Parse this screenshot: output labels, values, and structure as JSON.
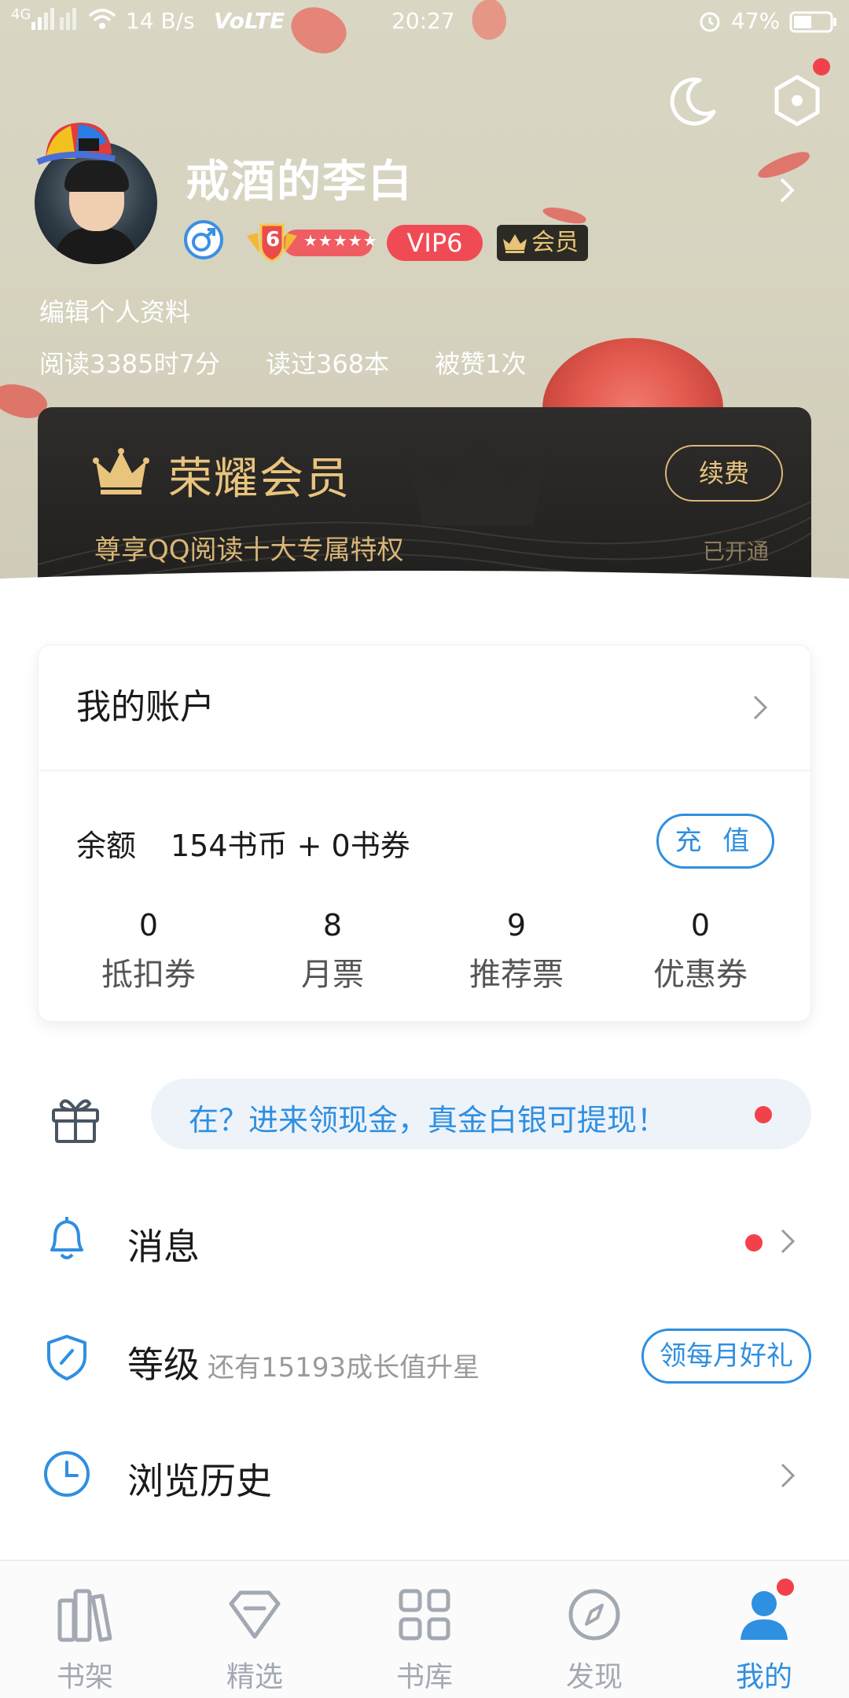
{
  "status_bar": {
    "network": "4G",
    "speed": "14 B/s",
    "volte": "VoLTE",
    "time": "20:27",
    "battery": "47%"
  },
  "header": {
    "username": "戒酒的李白",
    "level_number": "6",
    "level_stars": "★★★★★",
    "vip_label": "VIP6",
    "member_label": "会员",
    "edit_profile": "编辑个人资料",
    "stats": {
      "reading_time": "阅读3385时7分",
      "books_read": "读过368本",
      "likes": "被赞1次"
    }
  },
  "vip_card": {
    "title": "荣耀会员",
    "subtitle": "尊享QQ阅读十大专属特权",
    "renew_label": "续费",
    "status": "已开通"
  },
  "account": {
    "title": "我的账户",
    "balance_label": "余额",
    "balance_value": "154书币 + 0书券",
    "recharge_label": "充 值",
    "tickets": [
      {
        "value": "0",
        "label": "抵扣券"
      },
      {
        "value": "8",
        "label": "月票"
      },
      {
        "value": "9",
        "label": "推荐票"
      },
      {
        "value": "0",
        "label": "优惠券"
      }
    ]
  },
  "promo": {
    "text": "在？进来领现金，真金白银可提现！"
  },
  "menu": {
    "messages": "消息",
    "level": "等级",
    "level_sub": "还有15193成长值升星",
    "monthly_gift": "领每月好礼",
    "history": "浏览历史"
  },
  "tabs": [
    {
      "label": "书架",
      "icon": "bookshelf-icon"
    },
    {
      "label": "精选",
      "icon": "diamond-icon"
    },
    {
      "label": "书库",
      "icon": "grid-icon"
    },
    {
      "label": "发现",
      "icon": "compass-icon"
    },
    {
      "label": "我的",
      "icon": "profile-icon"
    }
  ],
  "colors": {
    "accent": "#2f8fe0",
    "gold": "#e9c47d",
    "red_dot": "#f2414a",
    "vip_red": "#f04b55"
  }
}
